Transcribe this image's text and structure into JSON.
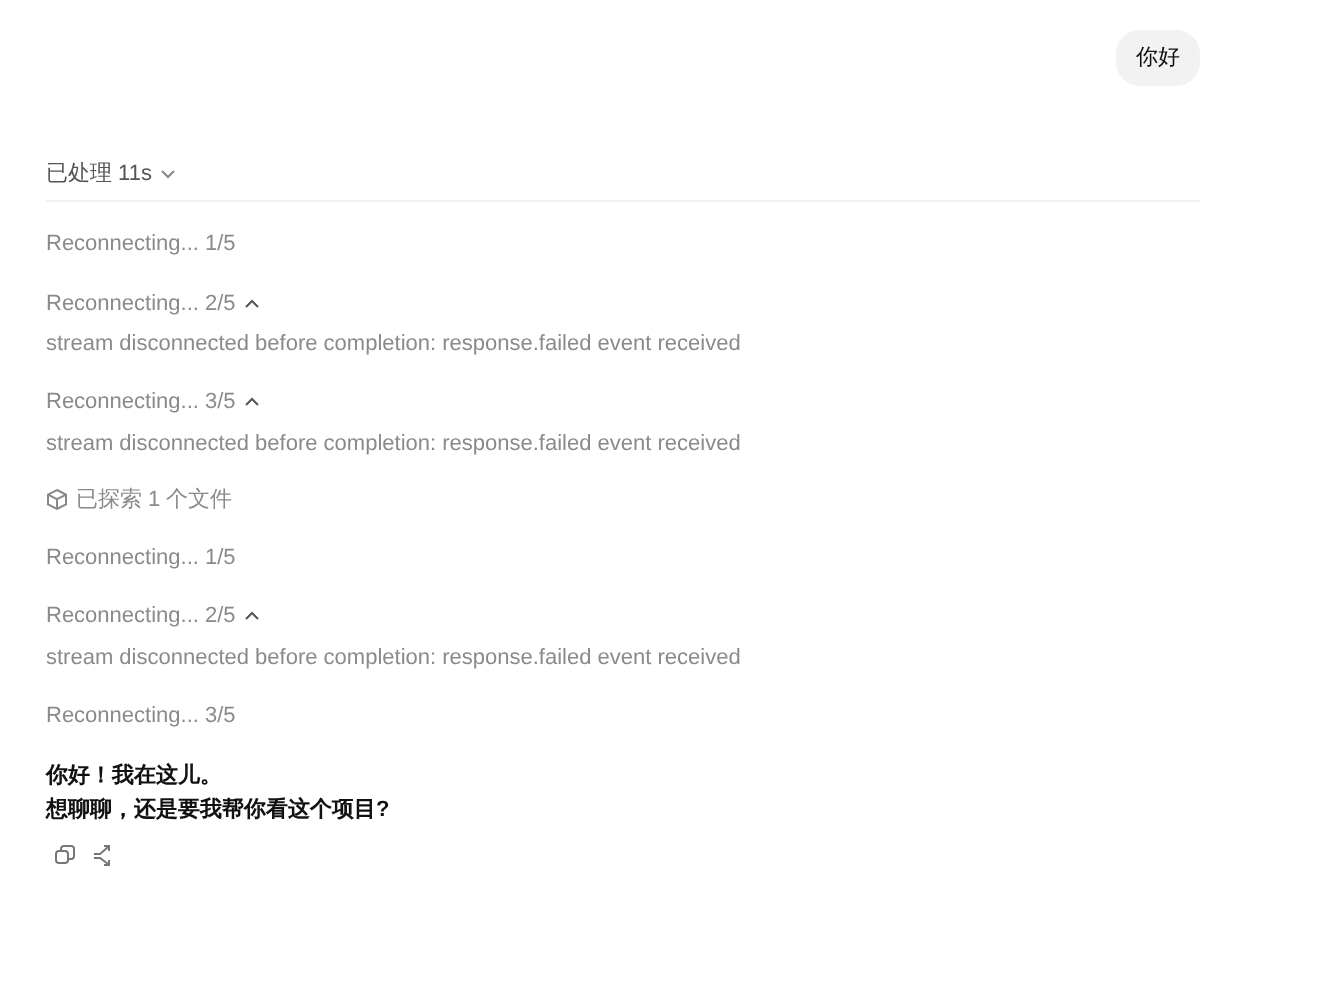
{
  "user_message": {
    "text": "你好"
  },
  "process": {
    "label": "已处理 11s",
    "expanded": false
  },
  "log": [
    {
      "kind": "reconnect",
      "text": "Reconnecting... 1/5"
    },
    {
      "kind": "reconnect",
      "text": "Reconnecting... 2/5",
      "expanded": true,
      "detail": "stream disconnected before completion: response.failed event received"
    },
    {
      "kind": "reconnect",
      "text": "Reconnecting... 3/5",
      "expanded": true,
      "detail": "stream disconnected before completion: response.failed event received"
    },
    {
      "kind": "explore",
      "text": "已探索 1 个文件"
    },
    {
      "kind": "reconnect",
      "text": "Reconnecting... 1/5"
    },
    {
      "kind": "reconnect",
      "text": "Reconnecting... 2/5",
      "expanded": true,
      "detail": "stream disconnected before completion: response.failed event received"
    },
    {
      "kind": "reconnect",
      "text": "Reconnecting... 3/5"
    }
  ],
  "reply": {
    "lines": [
      "你好！我在这儿。",
      "想聊聊，还是要我帮你看这个项目?"
    ]
  }
}
